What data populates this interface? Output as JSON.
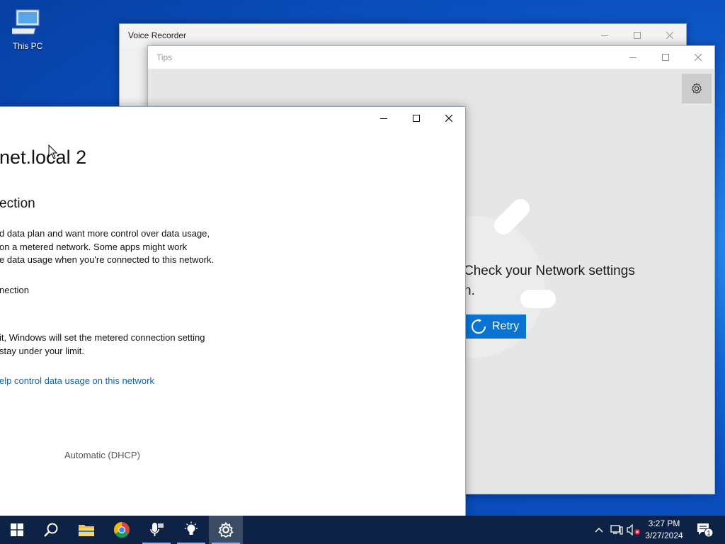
{
  "desktop": {
    "icons": [
      {
        "label": "This PC",
        "icon": "computer-icon"
      }
    ]
  },
  "voice_recorder": {
    "title": "Voice Recorder"
  },
  "tips": {
    "title": "Tips",
    "error_line1": "Check your Network settings",
    "error_line2": "n.",
    "retry_label": "Retry"
  },
  "settings": {
    "heading": "net.local 2",
    "subheading": "ection",
    "para_line1": "d data plan and want more control over data usage,",
    "para_line2": "on a metered network. Some apps might work",
    "para_line3": "e data usage when you're connected to this network.",
    "toggle_label": "nection",
    "para2_line1": "it, Windows will set the metered connection setting",
    "para2_line2": "stay under your limit.",
    "link_text": "elp control data usage on this network",
    "ip_assignment_value": "Automatic (DHCP)"
  },
  "taskbar": {
    "items": [
      "Start",
      "Search",
      "File Explorer",
      "Google Chrome",
      "Voice Recorder",
      "Tips",
      "Settings"
    ],
    "clock_time": "3:27 PM",
    "clock_date": "3/27/2024",
    "notification_count": "1"
  },
  "colors": {
    "accent": "#0a74d4",
    "link": "#0b66b5",
    "taskbar": "#0d2244"
  }
}
